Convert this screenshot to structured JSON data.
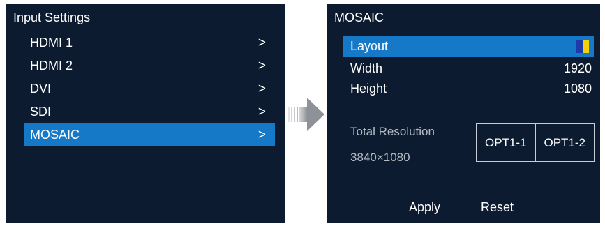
{
  "left": {
    "title": "Input Settings",
    "items": [
      {
        "label": "HDMI 1",
        "chevron": ">"
      },
      {
        "label": "HDMI 2",
        "chevron": ">"
      },
      {
        "label": "DVI",
        "chevron": ">"
      },
      {
        "label": "SDI",
        "chevron": ">"
      },
      {
        "label": "MOSAIC",
        "chevron": ">"
      }
    ],
    "selected_index": 4
  },
  "right": {
    "title": "MOSAIC",
    "layout": {
      "label": "Layout",
      "swatch_colors": [
        "#1d3aa8",
        "#f1d20a"
      ],
      "icon": "layout-swatch-icon"
    },
    "width": {
      "label": "Width",
      "value": "1920"
    },
    "height": {
      "label": "Height",
      "value": "1080"
    },
    "total_resolution_label": "Total Resolution",
    "total_resolution_value": "3840×1080",
    "options": [
      "OPT1-1",
      "OPT1-2"
    ],
    "apply_label": "Apply",
    "reset_label": "Reset"
  },
  "colors": {
    "panel_bg": "#0c1b30",
    "selection": "#1579c7",
    "muted_text": "#b6bcc6",
    "arrow_gray": "#8e9198"
  }
}
